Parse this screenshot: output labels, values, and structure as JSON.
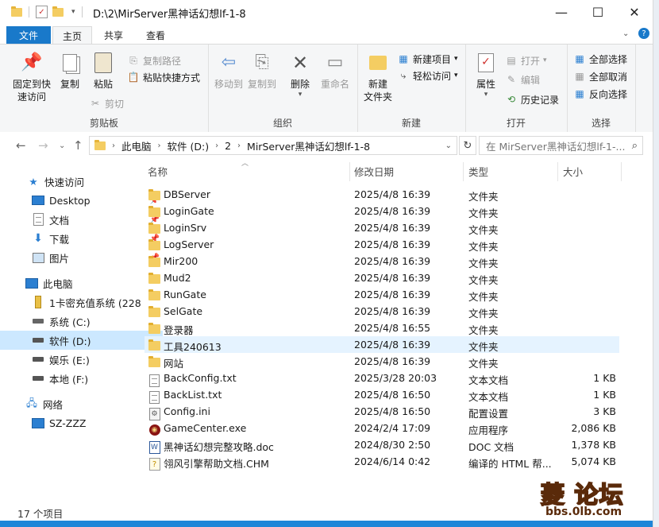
{
  "window": {
    "title": "D:\\2\\MirServer黑神话幻想lf-1-8",
    "minimize_glyph": "—",
    "maximize_glyph": "☐",
    "close_glyph": "✕"
  },
  "ribbon_tabs": {
    "file": "文件",
    "home": "主页",
    "share": "共享",
    "view": "查看"
  },
  "ribbon": {
    "clipboard": {
      "label": "剪贴板",
      "pin": "固定到快\n速访问",
      "copy": "复制",
      "paste": "粘贴",
      "copy_path": "复制路径",
      "paste_shortcut": "粘贴快捷方式",
      "cut": "剪切"
    },
    "organize": {
      "label": "组织",
      "move_to": "移动到",
      "copy_to": "复制到",
      "delete": "删除",
      "rename": "重命名"
    },
    "new": {
      "label": "新建",
      "new_folder": "新建\n文件夹",
      "new_item": "新建项目",
      "easy_access": "轻松访问"
    },
    "open": {
      "label": "打开",
      "properties": "属性",
      "open": "打开",
      "edit": "编辑",
      "history": "历史记录"
    },
    "select": {
      "label": "选择",
      "select_all": "全部选择",
      "select_none": "全部取消",
      "invert": "反向选择"
    }
  },
  "address": {
    "crumbs": [
      "此电脑",
      "软件 (D:)",
      "2",
      "MirServer黑神话幻想lf-1-8"
    ],
    "search_placeholder": "在 MirServer黑神话幻想lf-1-..."
  },
  "nav": {
    "quick_access": "快速访问",
    "desktop": "Desktop",
    "documents": "文档",
    "downloads": "下载",
    "pictures": "图片",
    "this_pc": "此电脑",
    "drive_usb": "1卡密充值系统 (228",
    "drive_c": "系统 (C:)",
    "drive_d": "软件 (D:)",
    "drive_e": "娱乐 (E:)",
    "drive_f": "本地 (F:)",
    "network": "网络",
    "computer": "SZ-ZZZ"
  },
  "columns": {
    "name": "名称",
    "date": "修改日期",
    "type": "类型",
    "size": "大小"
  },
  "files": [
    {
      "name": "DBServer",
      "date": "2025/4/8 16:39",
      "type": "文件夹",
      "size": "",
      "icon": "folder"
    },
    {
      "name": "LoginGate",
      "date": "2025/4/8 16:39",
      "type": "文件夹",
      "size": "",
      "icon": "folder"
    },
    {
      "name": "LoginSrv",
      "date": "2025/4/8 16:39",
      "type": "文件夹",
      "size": "",
      "icon": "folder"
    },
    {
      "name": "LogServer",
      "date": "2025/4/8 16:39",
      "type": "文件夹",
      "size": "",
      "icon": "folder"
    },
    {
      "name": "Mir200",
      "date": "2025/4/8 16:39",
      "type": "文件夹",
      "size": "",
      "icon": "folder"
    },
    {
      "name": "Mud2",
      "date": "2025/4/8 16:39",
      "type": "文件夹",
      "size": "",
      "icon": "folder"
    },
    {
      "name": "RunGate",
      "date": "2025/4/8 16:39",
      "type": "文件夹",
      "size": "",
      "icon": "folder"
    },
    {
      "name": "SelGate",
      "date": "2025/4/8 16:39",
      "type": "文件夹",
      "size": "",
      "icon": "folder"
    },
    {
      "name": "登录器",
      "date": "2025/4/8 16:55",
      "type": "文件夹",
      "size": "",
      "icon": "folder"
    },
    {
      "name": "工具240613",
      "date": "2025/4/8 16:39",
      "type": "文件夹",
      "size": "",
      "icon": "folder"
    },
    {
      "name": "网站",
      "date": "2025/4/8 16:39",
      "type": "文件夹",
      "size": "",
      "icon": "folder"
    },
    {
      "name": "BackConfig.txt",
      "date": "2025/3/28 20:03",
      "type": "文本文档",
      "size": "1 KB",
      "icon": "text-file"
    },
    {
      "name": "BackList.txt",
      "date": "2025/4/8 16:50",
      "type": "文本文档",
      "size": "1 KB",
      "icon": "text-file"
    },
    {
      "name": "Config.ini",
      "date": "2025/4/8 16:50",
      "type": "配置设置",
      "size": "3 KB",
      "icon": "ini-file"
    },
    {
      "name": "GameCenter.exe",
      "date": "2024/2/4 17:09",
      "type": "应用程序",
      "size": "2,086 KB",
      "icon": "exe-file"
    },
    {
      "name": "黑神话幻想完整攻略.doc",
      "date": "2024/8/30 2:50",
      "type": "DOC 文档",
      "size": "1,378 KB",
      "icon": "word-file"
    },
    {
      "name": "翎风引擎帮助文档.CHM",
      "date": "2024/6/14 0:42",
      "type": "编译的 HTML 帮...",
      "size": "5,074 KB",
      "icon": "chm-file"
    }
  ],
  "status": {
    "count": "17 个项目"
  },
  "watermark": {
    "main": "菱 论坛",
    "sub": "bbs.0lb.com"
  }
}
